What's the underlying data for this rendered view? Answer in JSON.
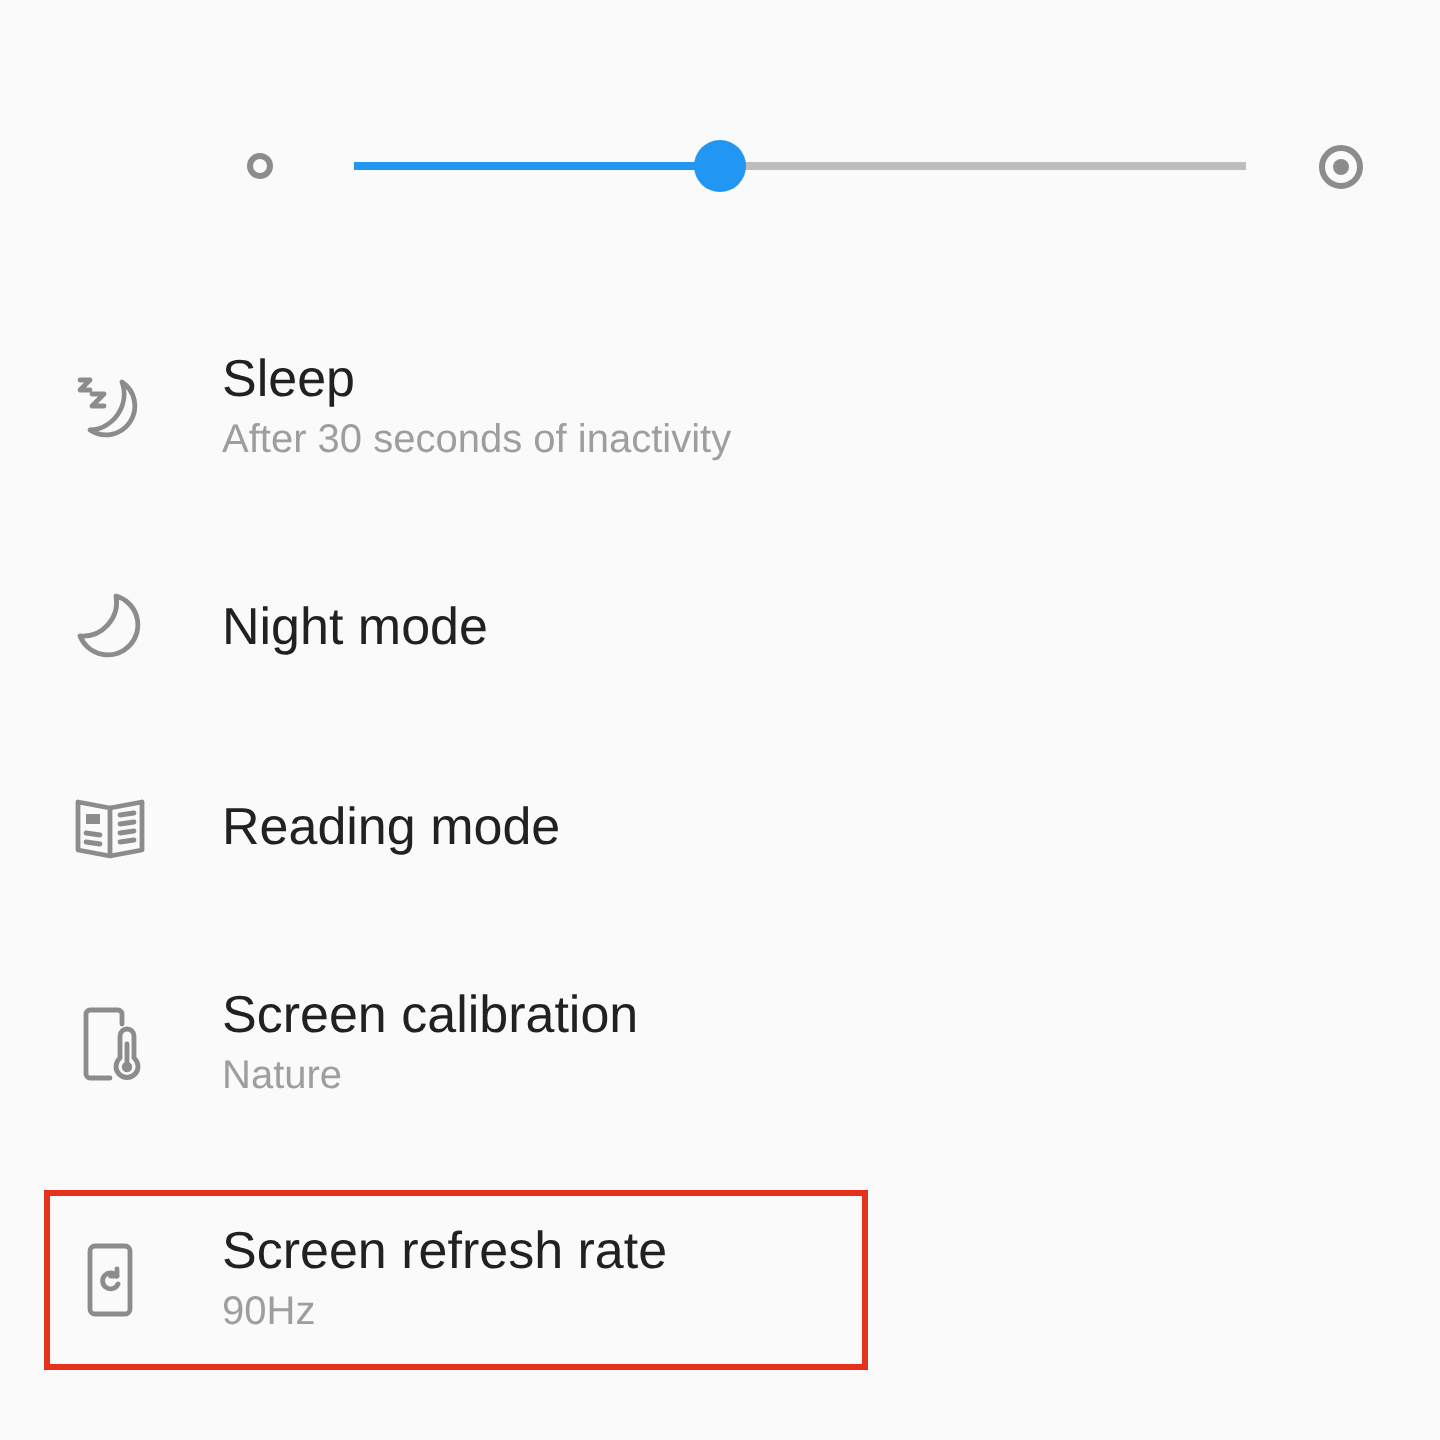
{
  "slider": {
    "level": 0.41
  },
  "settings": [
    {
      "kind": "sleep",
      "title": "Sleep",
      "subtitle": "After 30 seconds of inactivity",
      "highlighted": false
    },
    {
      "kind": "night",
      "title": "Night mode",
      "highlighted": false
    },
    {
      "kind": "reading",
      "title": "Reading mode",
      "highlighted": false
    },
    {
      "kind": "calibration",
      "title": "Screen calibration",
      "subtitle": "Nature",
      "highlighted": false
    },
    {
      "kind": "refresh",
      "title": "Screen refresh rate",
      "subtitle": "90Hz",
      "highlighted": true
    }
  ]
}
